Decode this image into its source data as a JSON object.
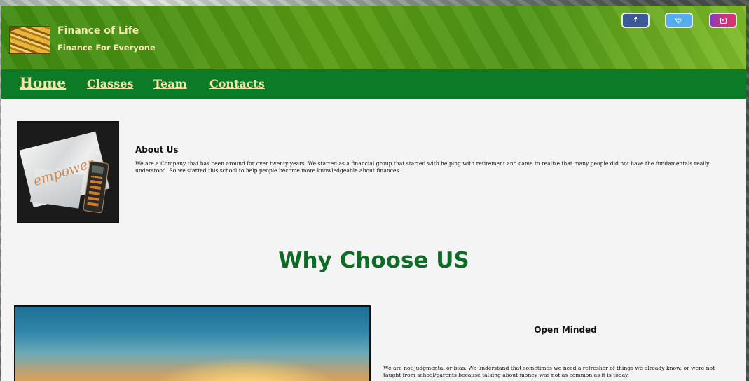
{
  "header": {
    "title": "Finance of Life",
    "tagline": "Finance For Everyone",
    "social": [
      {
        "name": "facebook",
        "glyph": "f"
      },
      {
        "name": "twitter",
        "glyph": "t"
      },
      {
        "name": "instagram",
        "glyph": ""
      }
    ]
  },
  "nav": {
    "items": [
      "Home",
      "Classes",
      "Team",
      "Contacts"
    ]
  },
  "about": {
    "image_word": "empower",
    "title": "About Us",
    "text": "We are a Company that has been around for over twenty years. We started as a financial group that started with helping with retirement and came to realize that many people did not have the fundamentals really understood. So we started this school to help people become more knowledgeable about finances."
  },
  "why": {
    "title": "Why Choose US",
    "open_title": "Open Minded",
    "open_text": "We are not judgmental or bias. We understand that sometimes we need a refresher of things we already know, or were not taught from school/parents because talking about money was not as common as it is today."
  },
  "colors": {
    "nav_bg": "#0d7a27",
    "heading_green": "#0d6b26",
    "link_gold": "#f6e3a6"
  }
}
